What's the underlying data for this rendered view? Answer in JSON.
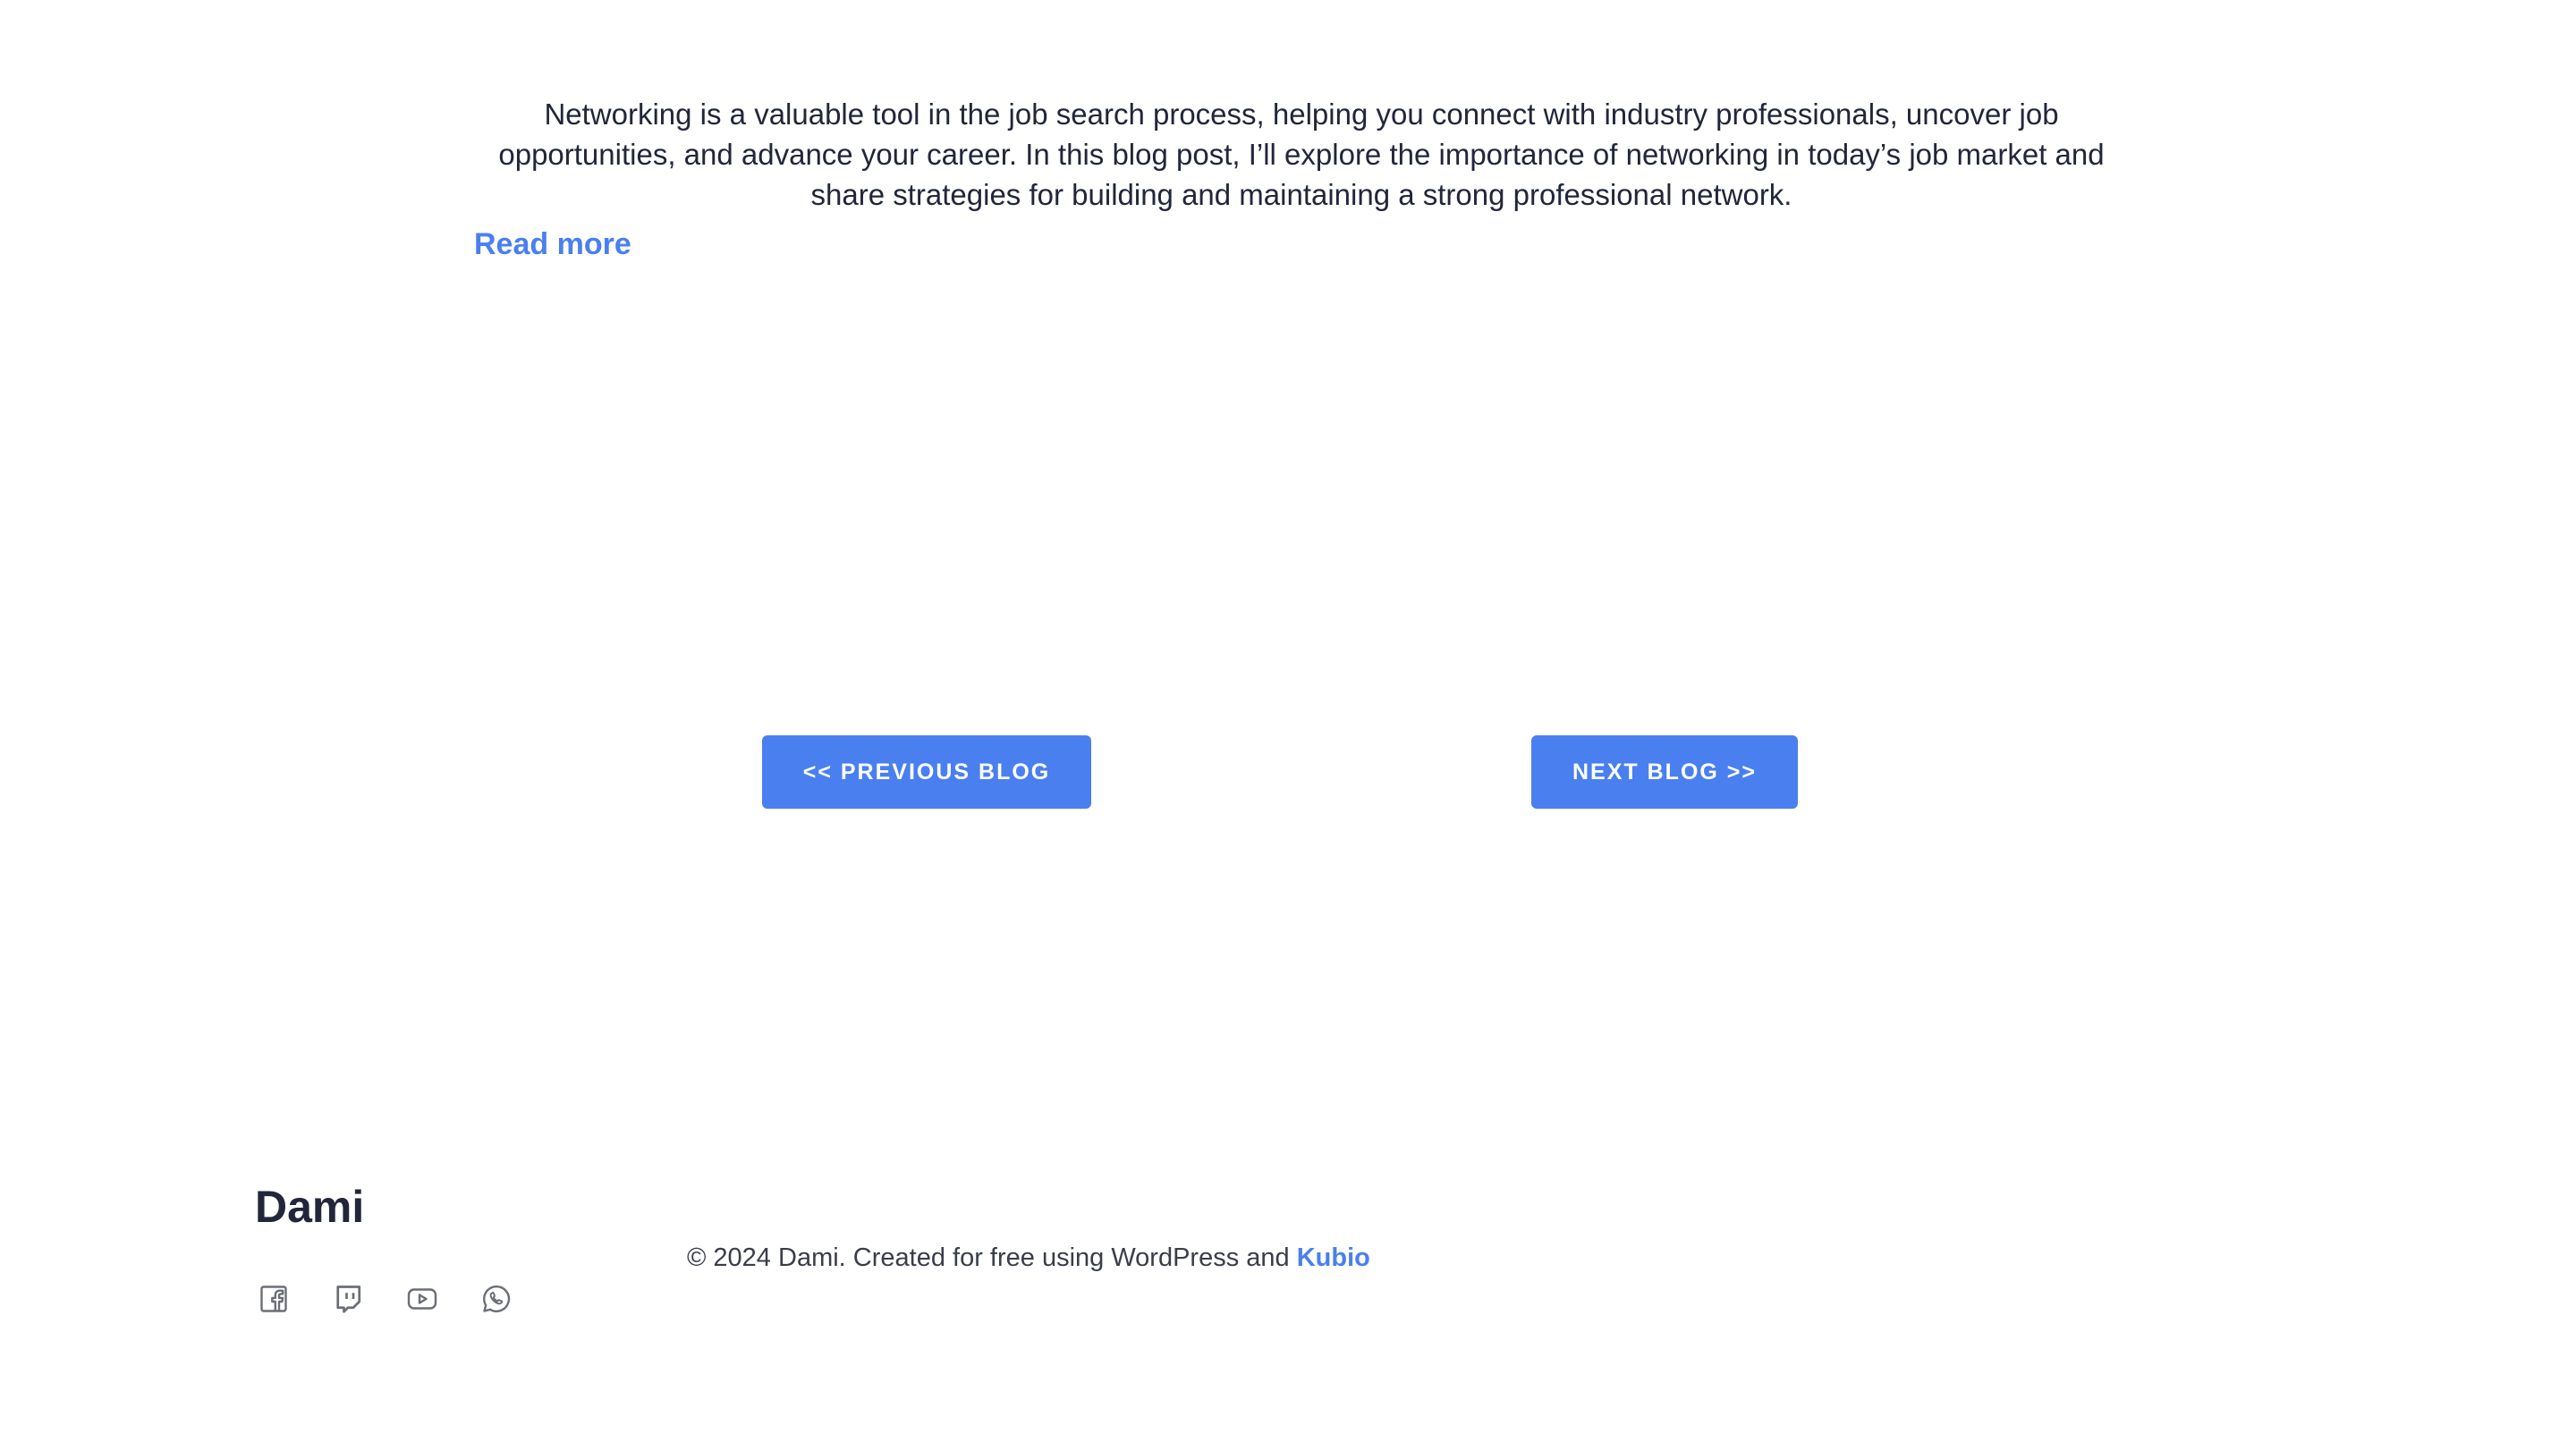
{
  "post": {
    "excerpt": "Networking is a valuable tool in the job search process, helping you connect with industry professionals, uncover job opportunities, and advance your career. In this blog post, I’ll explore the importance of networking in today’s job market and share strategies for building and maintaining a strong professional network.",
    "read_more": "Read more"
  },
  "navigation": {
    "previous_label": "<< PREVIOUS BLOG",
    "next_label": "NEXT BLOG >>"
  },
  "footer": {
    "brand": "Dami",
    "copyright_prefix": "© 2024 Dami. Created for free using WordPress and",
    "kubio_link": "Kubio",
    "social_icons": [
      "facebook-icon",
      "twitch-icon",
      "youtube-icon",
      "whatsapp-icon"
    ]
  },
  "colors": {
    "accent": "#4a7ff0",
    "text": "#22263a",
    "icon": "#6b6e78"
  }
}
